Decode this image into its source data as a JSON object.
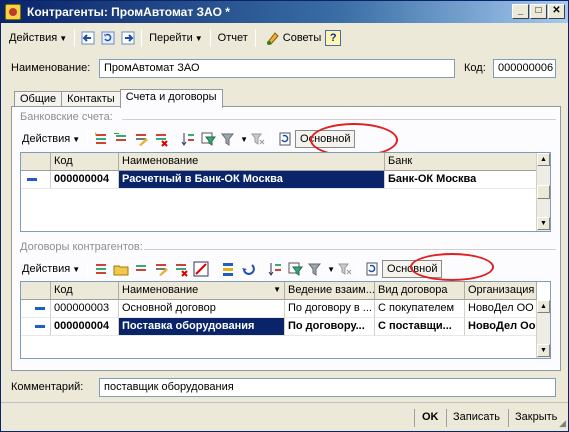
{
  "window": {
    "title": "Контрагенты: ПромАвтомат ЗАО *",
    "minimize": "_",
    "maximize": "□",
    "close": "✕"
  },
  "toolbar": {
    "actions_label": "Действия",
    "goto_label": "Перейти",
    "report_label": "Отчет",
    "tips_label": "Советы",
    "help_label": "?"
  },
  "form": {
    "name_label": "Наименование:",
    "name_value": "ПромАвтомат ЗАО",
    "code_label": "Код:",
    "code_value": "000000006",
    "comment_label": "Комментарий:",
    "comment_value": "поставщик оборудования"
  },
  "tabs": [
    {
      "label": "Общие"
    },
    {
      "label": "Контакты"
    },
    {
      "label": "Счета и договоры",
      "active": true
    }
  ],
  "bank": {
    "group_title": "Банковские счета:",
    "actions_label": "Действия",
    "main_button": "Основной",
    "columns": [
      "Код",
      "Наименование",
      "Банк"
    ],
    "rows": [
      {
        "code": "000000004",
        "name": "Расчетный в Банк-ОК Москва",
        "bank": "Банк-ОК Москва"
      }
    ]
  },
  "contracts": {
    "group_title": "Договоры контрагентов:",
    "actions_label": "Действия",
    "main_button": "Основной",
    "columns": [
      "Код",
      "Наименование",
      "Ведение взаим...",
      "Вид договора",
      "Организация"
    ],
    "rows": [
      {
        "code": "000000003",
        "name": "Основной договор",
        "mode": "По договору в ...",
        "kind": "С покупателем",
        "org": "НовоДел ОО"
      },
      {
        "code": "000000004",
        "name": "Поставка оборудования",
        "mode": "По договору...",
        "kind": "С поставщи...",
        "org": "НовоДел Оо"
      }
    ]
  },
  "footer": {
    "ok_label": "OK",
    "save_label": "Записать",
    "close_label": "Закрыть"
  },
  "icons": [
    "app-icon",
    "arrow-left-icon",
    "refresh-icon",
    "arrow-right-icon",
    "tips-icon",
    "help-icon",
    "add-icon",
    "copy-icon",
    "add-group-icon",
    "edit-icon",
    "delete-icon",
    "filter-icon",
    "filter-list-icon",
    "filter-clear-icon",
    "refresh-list-icon",
    "folder-icon",
    "hierarchy-icon",
    "move-icon",
    "sort-icon"
  ],
  "colors": {
    "title_bar": "#0a246a",
    "selection": "#0a246a",
    "highlight_ellipse": "#e02020"
  }
}
